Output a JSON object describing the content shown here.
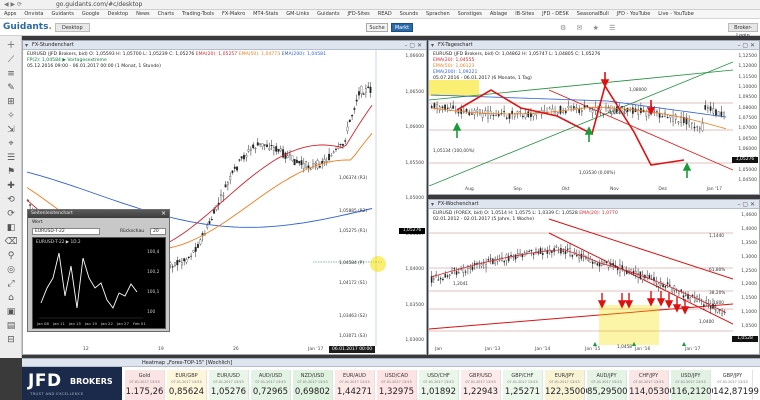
{
  "browser": {
    "url": "go.guidants.com/#c/desktop",
    "bookmarks": [
      "Apps",
      "Onvista",
      "Guidants",
      "Google",
      "Desktop",
      "News",
      "Charts",
      "Trading-Tools",
      "FX-Makro",
      "MT4-Stats",
      "GM-Links",
      "Guidants",
      "JFD-Sites",
      "READ",
      "Sounds",
      "Sprachen",
      "Sonstiges",
      "Ablage",
      "IB-Sites",
      "JFD - DESK",
      "SeasonalBull",
      "JFD - YouTube",
      "Live - YouTube"
    ]
  },
  "app": {
    "logo_main": "Guidants",
    "logo_dot": ".",
    "desk_label": "Desktop",
    "search_label": "Suche",
    "market_label": "Markt",
    "header_icons": "⚙ ✉ ★ ☰",
    "user_label": "Broker-Login"
  },
  "toolbar": {
    "icons": [
      "＋",
      "⟋",
      "≡",
      "✎",
      "⊞",
      "✧",
      "⇲",
      "⌖",
      "☰",
      "⚑",
      "✚",
      "⟲",
      "⟳",
      "◧",
      "⌫",
      "⚲",
      "◎",
      "⤢",
      "⌂",
      "▣",
      "▤",
      "⊟"
    ]
  },
  "panels": {
    "hourly": {
      "title": "FX-Stundenchart",
      "legend_line1": "EURUSD (JFD Brokers, bid)  O: 1,05593  H: 1,05700  L: 1,05239  C: 1,05276",
      "legend_ema20": "EMA(20): 1,05257",
      "legend_ema50": "EMA(50): 1,04773",
      "legend_ema200": "EMA(200): 1,04581",
      "legend_line2": "FP(2): 1,04584  ▶ Vortagesextreme",
      "legend_line3": "05.12.2016 09:00 - 06.01.2017 00:00  (1 Monat, 1 Stunde)",
      "y_ticks": [
        "1,06600",
        "1,06500",
        "1,06000",
        "1,05500",
        "1,05000",
        "1,04557",
        "1,04000",
        "1,03500",
        "1,03000"
      ],
      "price_tag": "1,05276",
      "pivot_labels": [
        "1,06374 (R3)",
        "1,05885 (R2)",
        "1,05275 (R1)",
        "1,04584 (P)",
        "1,04172 (S1)",
        "1,03463 (S2)",
        "1,03071 (S3)"
      ],
      "x_ticks": [
        "12",
        "19",
        "26",
        "Jan '17"
      ],
      "x_cursor": "06.01.2017 00:00"
    },
    "daily": {
      "title": "FX-Tageschart",
      "legend_line1": "EURUSD (JFD Brokers, bid)  O: 1,04862  H: 1,05747  L: 1,04805  C: 1,05276",
      "legend_ema20": "EMA(20): 1,04555",
      "legend_ema50": "EMA(50): 1,06123",
      "legend_ema200": "EMA(200): 1,09221",
      "legend_line2": "05.07.2016 - 06.01.2017  (6 Monate, 1 Tag)",
      "y_ticks": [
        "1,12500",
        "1,12000",
        "1,11500",
        "1,10000",
        "1,09500",
        "1,08000",
        "1,07500",
        "1,07000",
        "1,06500",
        "1,06000",
        "1,05500",
        "1,05000",
        "1,04500"
      ],
      "price_tag": "1,05276",
      "levels": [
        "1,05134 (100,00%)",
        "1,03530 (0,00%)",
        "1,06000",
        "1,08000"
      ],
      "x_ticks": [
        "Aug",
        "Sep",
        "Okt",
        "Nov",
        "Dez",
        "Jan '17"
      ]
    },
    "weekly": {
      "title": "FX-Wochenchart",
      "legend_line1": "EURUSD (FOREX, bid)  O: 1,0514  H: 1,0575  L: 1,0339  C: 1,0528",
      "legend_ema20": "EMA(20): 1,0770",
      "legend_line2": "02.01.2012 - 02.01.2017  (5 Jahre, 1 Woche)",
      "y_ticks": [
        "1,4600",
        "1,4000",
        "1,3500",
        "1,3000",
        "1,2500",
        "1,2000",
        "1,1500",
        "1,1000",
        "1,0500",
        "1,0000"
      ],
      "price_tag": "1,0528",
      "levels": [
        "1,2041",
        "61,80%",
        "38,20%",
        "1,1800",
        "1,0458",
        "1,0400",
        "1,1440"
      ],
      "x_ticks": [
        "Jan",
        "Jan '13",
        "Jan '14",
        "Jan '15",
        "Jan '16",
        "Jan '17"
      ]
    }
  },
  "popup": {
    "title": "Seitenleistenchart",
    "close": "×",
    "label_wert": "Wert",
    "selected": "EURUSD-T-22",
    "label_ruckschau": "Rückschau",
    "ruckschau_value": "20",
    "series_label": "EURUSD-T-22 ▶ 1D.2",
    "y_ticks": [
      "100,4",
      "100,2",
      "100,1",
      "100"
    ],
    "x_ticks": [
      "Jan 08",
      "Jan 11",
      "Jan 15",
      "Jan 19",
      "Jan 22",
      "Jan 27",
      "Feb 01"
    ]
  },
  "heatmap": {
    "title": "Heatmap „Forex-TOP-15\" [Wochlich]",
    "jfd_big": "JFD",
    "jfd_sub": "BROKERS",
    "jfd_tag": "TRUST AND EXCELLENCE",
    "tiles": [
      {
        "sym": "Gold",
        "meta": "07.01.2017 13:53",
        "val": "1.175,26"
      },
      {
        "sym": "EUR/GBP",
        "meta": "07.01.2017 13:53",
        "val": "0,85624"
      },
      {
        "sym": "EUR/USD",
        "meta": "07.01.2017 13:53",
        "val": "1,05276"
      },
      {
        "sym": "AUD/USD",
        "meta": "07.01.2017 13:53",
        "val": "0,72965"
      },
      {
        "sym": "NZD/USD",
        "meta": "07.01.2017 13:53",
        "val": "0,69802"
      },
      {
        "sym": "EUR/AUD",
        "meta": "07.01.2017 13:53",
        "val": "1,44271"
      },
      {
        "sym": "USD/CAD",
        "meta": "07.01.2017 13:53",
        "val": "1,32975"
      },
      {
        "sym": "USD/CHF",
        "meta": "07.01.2017 13:53",
        "val": "1,01892"
      },
      {
        "sym": "GBP/USD",
        "meta": "07.01.2017 13:53",
        "val": "1,22943"
      },
      {
        "sym": "GBP/CHF",
        "meta": "07.01.2017 13:53",
        "val": "1,25271"
      },
      {
        "sym": "EUR/JPY",
        "meta": "07.01.2017 13:53",
        "val": "122,35000"
      },
      {
        "sym": "AUD/JPY",
        "meta": "07.01.2017 13:53",
        "val": "85,29500"
      },
      {
        "sym": "CHF/JPY",
        "meta": "07.01.2017 13:53",
        "val": "114,05300"
      },
      {
        "sym": "USD/JPY",
        "meta": "07.01.2017 13:53",
        "val": "116,21200"
      },
      {
        "sym": "GBP/JPY",
        "meta": "07.01.2017 13:53",
        "val": "142,87199"
      }
    ],
    "tile_colors": [
      "#fbe4e4",
      "#fff6dc",
      "#e8f5e8",
      "#e3f3e3",
      "#dff1df",
      "#fde8e8",
      "#fde3e3",
      "#e9f6e9",
      "#fdeaea",
      "#ecf7ec",
      "#f9f3d6",
      "#e4f3e4",
      "#fbe6e6",
      "#e2f2e2",
      "#ffffff"
    ]
  },
  "colors": {
    "ema20": "#d1242b",
    "ema50": "#f07c1c",
    "ema200": "#2b5fd6",
    "pivot": "#0a7a3a",
    "accent": "#2a6aa8"
  }
}
